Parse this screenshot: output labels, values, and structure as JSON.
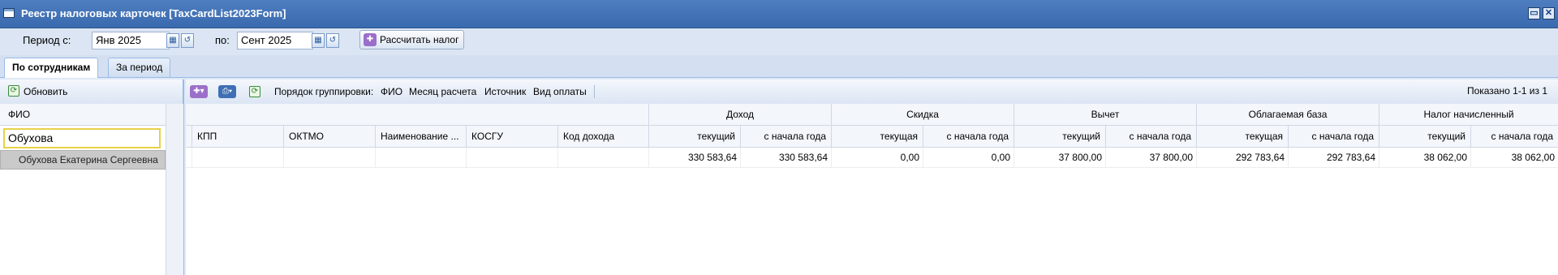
{
  "window": {
    "title": "Реестр налоговых карточек [TaxCardList2023Form]"
  },
  "period": {
    "from_label": "Период с:",
    "from_value": "Янв 2025",
    "to_label": "по:",
    "to_value": "Сент 2025",
    "calc_button": "Рассчитать налог"
  },
  "tabs": [
    {
      "label": "По сотрудникам",
      "active": true
    },
    {
      "label": "За период",
      "active": false
    }
  ],
  "left": {
    "refresh_label": "Обновить",
    "column_header": "ФИО",
    "filter_value": "Обухова",
    "rows": [
      "Обухова Екатерина Сергеевна"
    ]
  },
  "grid": {
    "grouping_label": "Порядок группировки:",
    "grouping_items": [
      "ФИО",
      "Месяц расчета",
      "Источник",
      "Вид оплаты"
    ],
    "shown": "Показано 1-1 из 1",
    "group_headers": [
      "Доход",
      "Скидка",
      "Вычет",
      "Облагаемая база",
      "Налог начисленный"
    ],
    "columns": [
      "КПП",
      "ОКТМО",
      "Наименование ...",
      "КОСГУ",
      "Код дохода",
      "текущий",
      "с начала года",
      "текущая",
      "с начала года",
      "текущий",
      "с начала года",
      "текущая",
      "с начала года",
      "текущий",
      "с начала года"
    ],
    "rows": [
      [
        "",
        "",
        "",
        "",
        "",
        "330 583,64",
        "330 583,64",
        "0,00",
        "0,00",
        "37 800,00",
        "37 800,00",
        "292 783,64",
        "292 783,64",
        "38 062,00",
        "38 062,00"
      ]
    ]
  },
  "colors": {
    "title_bar": "#4a7ab8",
    "panel_border": "#99bbe8",
    "selected_row": "#c9c9c9",
    "filter_border": "#e6d24a"
  }
}
